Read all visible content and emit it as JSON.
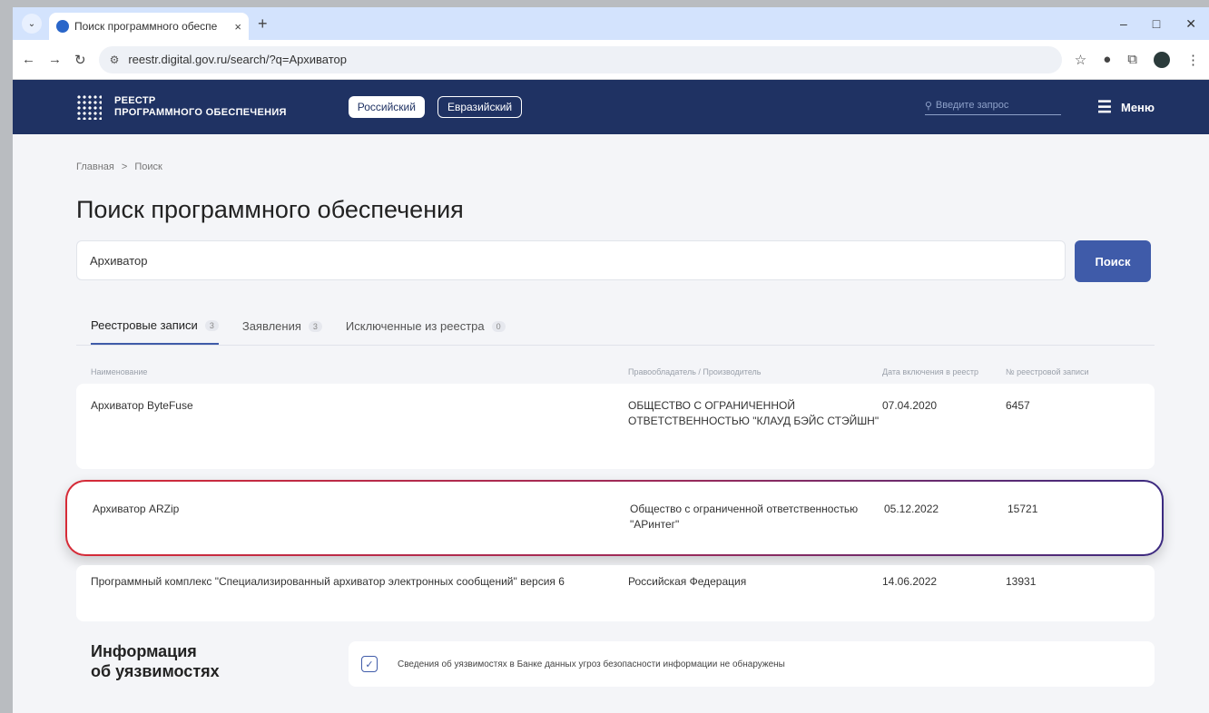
{
  "browser": {
    "tab_title": "Поиск программного обеспе",
    "tab_close": "×",
    "new_tab": "+",
    "url": "reestr.digital.gov.ru/search/?q=Архиватор",
    "controls": {
      "minimize": "–",
      "maximize": "□",
      "close": "✕"
    }
  },
  "header": {
    "logo_line1": "РЕЕСТР",
    "logo_line2": "ПРОГРАММНОГО ОБЕСПЕЧЕНИЯ",
    "pill_active": "Российский",
    "pill_inactive": "Евразийский",
    "search_placeholder": "Введите запрос",
    "menu_label": "Меню"
  },
  "breadcrumb": {
    "home": "Главная",
    "sep": ">",
    "current": "Поиск"
  },
  "page_title": "Поиск программного обеспечения",
  "search": {
    "value": "Архиватор",
    "button": "Поиск"
  },
  "tabs": [
    {
      "label": "Реестровые записи",
      "count": "3"
    },
    {
      "label": "Заявления",
      "count": "3"
    },
    {
      "label": "Исключенные из реестра",
      "count": "0"
    }
  ],
  "table": {
    "headers": {
      "name": "Наименование",
      "owner": "Правообладатель / Производитель",
      "date": "Дата включения в реестр",
      "number": "№ реестровой записи"
    },
    "rows": [
      {
        "name": "Архиватор ByteFuse",
        "owner": "ОБЩЕСТВО С ОГРАНИЧЕННОЙ ОТВЕТСТВЕННОСТЬЮ \"КЛАУД БЭЙС СТЭЙШН\"",
        "date": "07.04.2020",
        "number": "6457"
      },
      {
        "name": "Архиватор ARZip",
        "owner": "Общество с ограниченной ответственностью \"АРинтег\"",
        "date": "05.12.2022",
        "number": "15721"
      },
      {
        "name": "Программный комплекс \"Специализированный архиватор электронных сообщений\" версия 6",
        "owner": "Российская Федерация",
        "date": "14.06.2022",
        "number": "13931"
      }
    ]
  },
  "vulnerabilities": {
    "title_line1": "Информация",
    "title_line2": "об уязвимостях",
    "message": "Сведения об уязвимостях в Банке данных угроз безопасности информации не обнаружены"
  },
  "colors": {
    "header_bg": "#1f3263",
    "accent": "#3f5ba9",
    "highlight_start": "#d62b37",
    "highlight_end": "#3b2a80"
  }
}
